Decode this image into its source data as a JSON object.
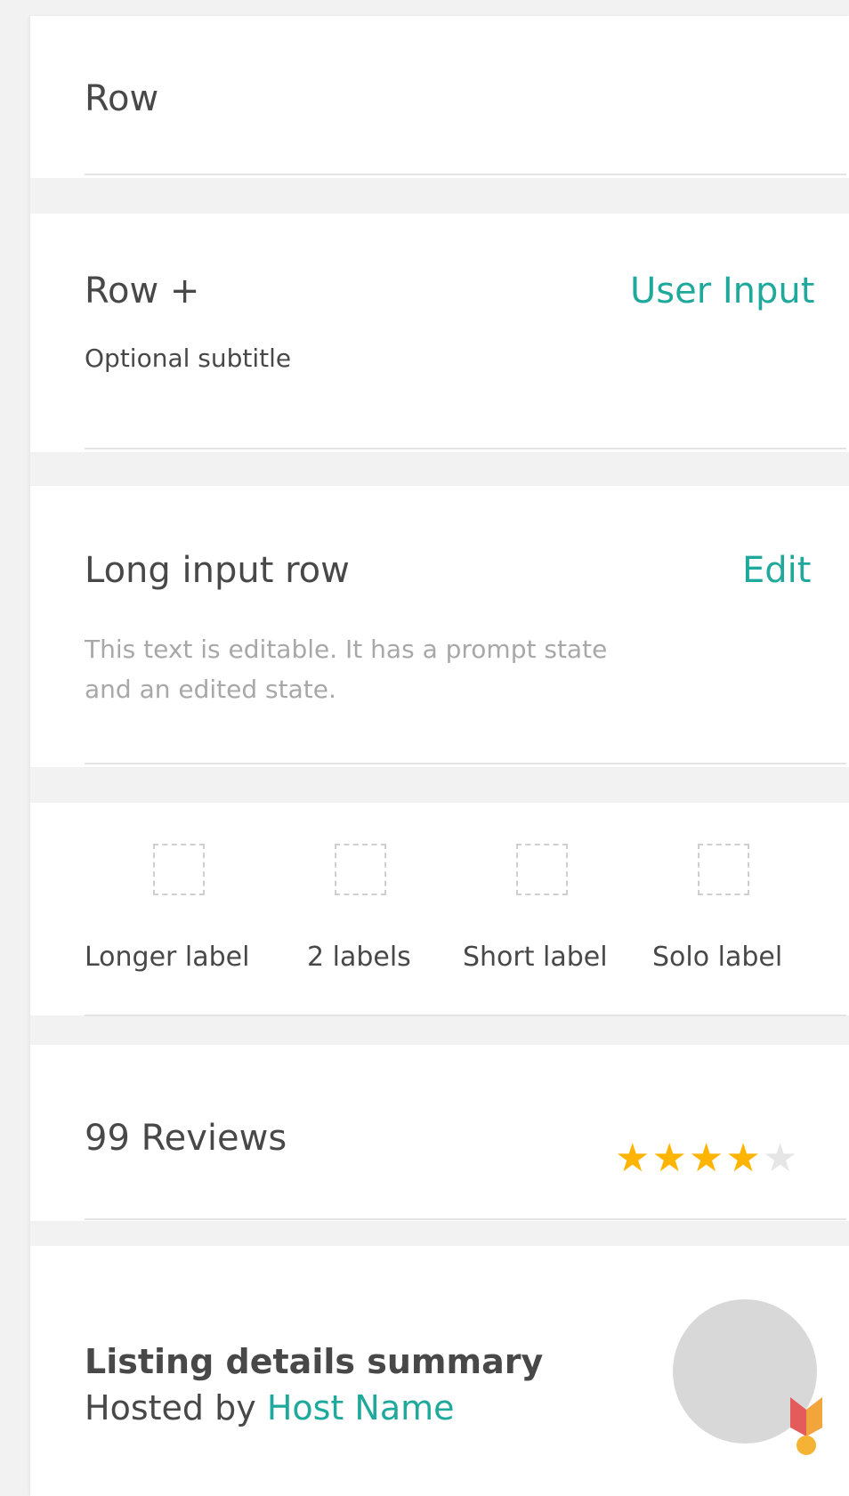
{
  "rows": {
    "simple": {
      "title": "Row"
    },
    "with_input": {
      "title": "Row +",
      "subtitle": "Optional subtitle",
      "input": "User Input"
    },
    "long_input": {
      "title": "Long input row",
      "action": "Edit",
      "body": "This text is editable. It has a prompt state and an edited state."
    },
    "icons": {
      "items": [
        {
          "label": "Longer label"
        },
        {
          "label": "2 labels"
        },
        {
          "label": "Short label"
        },
        {
          "label": "Solo label"
        }
      ]
    },
    "reviews": {
      "title": "99 Reviews",
      "rating": 4,
      "max_rating": 5
    },
    "listing": {
      "title": "Listing details summary",
      "hosted_by": "Hosted by",
      "host_name": "Host Name"
    }
  },
  "colors": {
    "accent": "#1fa99c",
    "star_on": "#ffb400",
    "star_off": "#e6e6e6",
    "avatar": "#d8d8d8",
    "badge_red": "#e35b5b",
    "badge_yellow": "#f5b335"
  }
}
